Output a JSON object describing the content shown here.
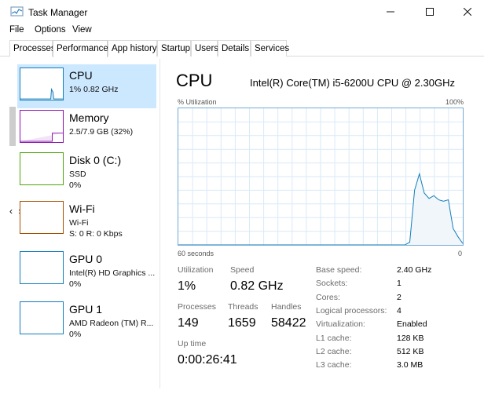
{
  "window": {
    "title": "Task Manager"
  },
  "menu": [
    "File",
    "Options",
    "View"
  ],
  "tabs": [
    "Processes",
    "Performance",
    "App history",
    "Startup",
    "Users",
    "Details",
    "Services"
  ],
  "sidebar": {
    "items": [
      {
        "title": "CPU",
        "line1": "1%  0.82 GHz",
        "line2": "",
        "color": "#117dbb"
      },
      {
        "title": "Memory",
        "line1": "2.5/7.9 GB (32%)",
        "line2": "",
        "color": "#8b12ae"
      },
      {
        "title": "Disk 0 (C:)",
        "line1": "SSD",
        "line2": "0%",
        "color": "#4da60c"
      },
      {
        "title": "Wi-Fi",
        "line1": "Wi-Fi",
        "line2": "S: 0  R: 0 Kbps",
        "color": "#a74f01"
      },
      {
        "title": "GPU 0",
        "line1": "Intel(R) HD Graphics ...",
        "line2": "0%",
        "color": "#117dbb"
      },
      {
        "title": "GPU 1",
        "line1": "AMD Radeon (TM) R...",
        "line2": "0%",
        "color": "#117dbb"
      }
    ],
    "nav_arrows": "‹ ›"
  },
  "main": {
    "title": "CPU",
    "model": "Intel(R) Core(TM) i5-6200U CPU @ 2.30GHz",
    "graph": {
      "y_label": "% Utilization",
      "y_max_label": "100%",
      "x_left_label": "60 seconds",
      "x_right_label": "0",
      "line_color": "#117dbb",
      "grid_color": "#d9eaf7",
      "values": [
        0,
        0,
        0,
        0,
        0,
        0,
        0,
        0,
        0,
        0,
        0,
        0,
        0,
        0,
        0,
        0,
        0,
        0,
        0,
        0,
        0,
        0,
        0,
        0,
        0,
        0,
        0,
        0,
        0,
        0,
        0,
        0,
        0,
        0,
        0,
        0,
        0,
        0,
        0,
        0,
        0,
        0,
        0,
        0,
        0,
        0,
        0,
        0,
        2,
        40,
        52,
        38,
        34,
        36,
        33,
        32,
        33,
        12,
        6,
        1
      ]
    },
    "stats": {
      "utilization_label": "Utilization",
      "utilization": "1%",
      "speed_label": "Speed",
      "speed": "0.82 GHz",
      "processes_label": "Processes",
      "processes": "149",
      "threads_label": "Threads",
      "threads": "1659",
      "handles_label": "Handles",
      "handles": "58422",
      "uptime_label": "Up time",
      "uptime": "0:00:26:41"
    },
    "specs": [
      {
        "key": "Base speed:",
        "value": "2.40 GHz"
      },
      {
        "key": "Sockets:",
        "value": "1"
      },
      {
        "key": "Cores:",
        "value": "2"
      },
      {
        "key": "Logical processors:",
        "value": "4"
      },
      {
        "key": "Virtualization:",
        "value": "Enabled"
      },
      {
        "key": "L1 cache:",
        "value": "128 KB"
      },
      {
        "key": "L2 cache:",
        "value": "512 KB"
      },
      {
        "key": "L3 cache:",
        "value": "3.0 MB"
      }
    ]
  }
}
